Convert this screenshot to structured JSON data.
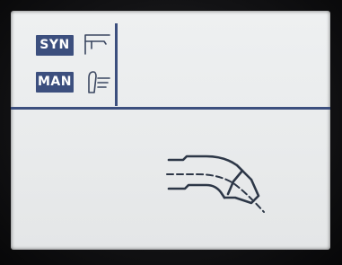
{
  "modes": {
    "synergic": {
      "label": "SYN",
      "icon": "synergic-torch-icon"
    },
    "manual": {
      "label": "MAN",
      "icon": "manual-torch-icon"
    }
  },
  "main": {
    "icon": "welding-torch-icon"
  },
  "colors": {
    "accent": "#3c4f7e",
    "screen": "#eceeef",
    "bezel": "#121214",
    "stroke": "#2d3747"
  }
}
